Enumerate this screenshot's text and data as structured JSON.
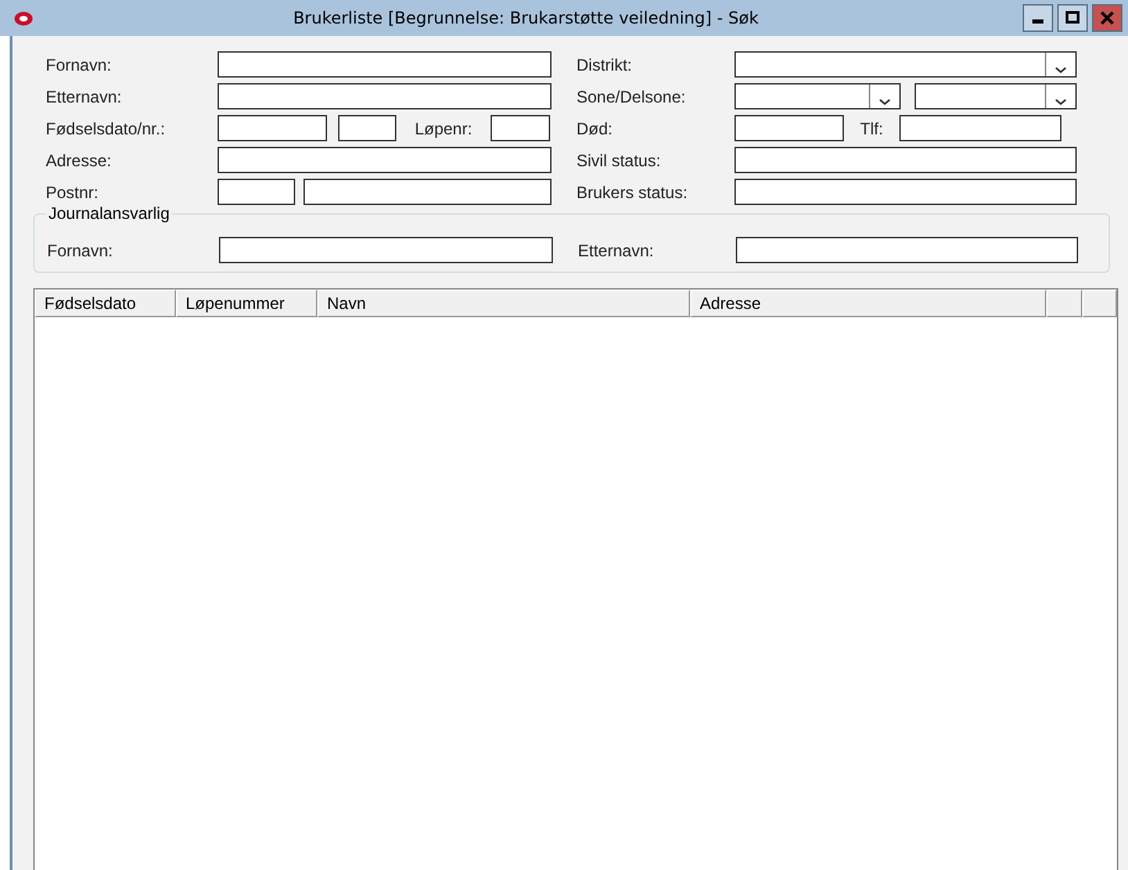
{
  "window": {
    "title": "Brukerliste  [Begrunnelse: Brukarstøtte veiledning] - Søk"
  },
  "form": {
    "left": [
      {
        "label": "Fornavn:",
        "fields": [
          {
            "kind": "text"
          }
        ]
      },
      {
        "label": "Etternavn:",
        "fields": [
          {
            "kind": "text"
          }
        ]
      },
      {
        "label": "Fødselsdato/nr.:",
        "fields": [
          {
            "kind": "text"
          },
          {
            "kind": "text"
          },
          {
            "kind": "label",
            "text": "Løpenr:"
          },
          {
            "kind": "text"
          }
        ]
      },
      {
        "label": "Adresse:",
        "fields": [
          {
            "kind": "text"
          }
        ]
      },
      {
        "label": "Postnr:",
        "fields": [
          {
            "kind": "text"
          },
          {
            "kind": "text"
          }
        ]
      }
    ],
    "right": [
      {
        "label": "Distrikt:",
        "fields": [
          {
            "kind": "dropdown"
          }
        ]
      },
      {
        "label": "Sone/Delsone:",
        "fields": [
          {
            "kind": "dropdown"
          },
          {
            "kind": "dropdown"
          }
        ]
      },
      {
        "label": "Død:",
        "fields": [
          {
            "kind": "text"
          },
          {
            "kind": "label",
            "text": "Tlf:"
          },
          {
            "kind": "text"
          }
        ]
      },
      {
        "label": "Sivil status:",
        "fields": [
          {
            "kind": "text"
          }
        ]
      },
      {
        "label": "Brukers status:",
        "fields": [
          {
            "kind": "text"
          }
        ]
      }
    ]
  },
  "group": {
    "title": "Journalansvarlig",
    "left": {
      "label": "Fornavn:",
      "fields": [
        {
          "kind": "text"
        }
      ]
    },
    "right": {
      "label": "Etternavn:",
      "fields": [
        {
          "kind": "text"
        }
      ]
    }
  },
  "table": {
    "columns": [
      "Fødselsdato",
      "Løpenummer",
      "Navn",
      "Adresse"
    ]
  }
}
